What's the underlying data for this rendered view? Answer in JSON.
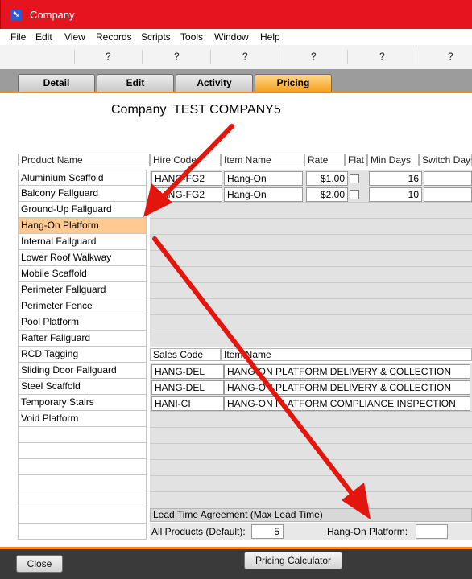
{
  "window": {
    "title": "Company",
    "app_icon": "filemaker-icon"
  },
  "menu": [
    "File",
    "Edit",
    "View",
    "Records",
    "Scripts",
    "Tools",
    "Window",
    "Help"
  ],
  "toolbar": {
    "buttons": [
      "?",
      "?",
      "?",
      "?",
      "?",
      "?"
    ]
  },
  "tabs": [
    {
      "label": "Detail",
      "active": false
    },
    {
      "label": "Edit",
      "active": false
    },
    {
      "label": "Activity",
      "active": false
    },
    {
      "label": "Pricing",
      "active": true
    }
  ],
  "company": {
    "label": "Company",
    "name": "TEST COMPANY5"
  },
  "product_list": {
    "header": "Product Name",
    "selected": "Hang-On Platform",
    "items": [
      "Aluminium Scaffold",
      "Balcony Fallguard",
      "Ground-Up Fallguard",
      "Hang-On Platform",
      "Internal Fallguard",
      "Lower Roof Walkway",
      "Mobile Scaffold",
      "Perimeter Fallguard",
      "Perimeter Fence",
      "Pool Platform",
      "Rafter Fallguard",
      "RCD Tagging",
      "Sliding Door Fallguard",
      "Steel Scaffold",
      "Temporary Stairs",
      "Void Platform"
    ]
  },
  "hire_table": {
    "columns": [
      "Hire Code",
      "Item Name",
      "Rate",
      "Flat",
      "Min Days",
      "Switch Days"
    ],
    "rows": [
      {
        "hire_code": "HANG-FG2",
        "item_name": "Hang-On",
        "rate": "$1.00",
        "flat": false,
        "min_days": "16",
        "switch_days": ""
      },
      {
        "hire_code": "HANG-FG2",
        "item_name": "Hang-On",
        "rate": "$2.00",
        "flat": false,
        "min_days": "10",
        "switch_days": ""
      }
    ]
  },
  "sales_table": {
    "columns": [
      "Sales Code",
      "Item Name"
    ],
    "rows": [
      {
        "sales_code": "HANG-DEL",
        "item_name": "HANG-ON PLATFORM DELIVERY & COLLECTION"
      },
      {
        "sales_code": "HANG-DEL",
        "item_name": "HANG-ON PLATFORM DELIVERY & COLLECTION"
      },
      {
        "sales_code": "HANI-CI",
        "item_name": "HANG-ON PLATFORM COMPLIANCE INSPECTION"
      }
    ]
  },
  "lead_time": {
    "header": "Lead Time Agreement (Max Lead Time)",
    "all_products_label": "All Products (Default):",
    "all_products_value": "5",
    "product_label": "Hang-On Platform:",
    "product_value": ""
  },
  "footer": {
    "close_label": "Close",
    "calculator_label": "Pricing Calculator"
  },
  "colors": {
    "accent": "#f08a1c",
    "titlebar": "#e5141e",
    "selection": "#ffc991",
    "arrow": "#e3160e"
  }
}
